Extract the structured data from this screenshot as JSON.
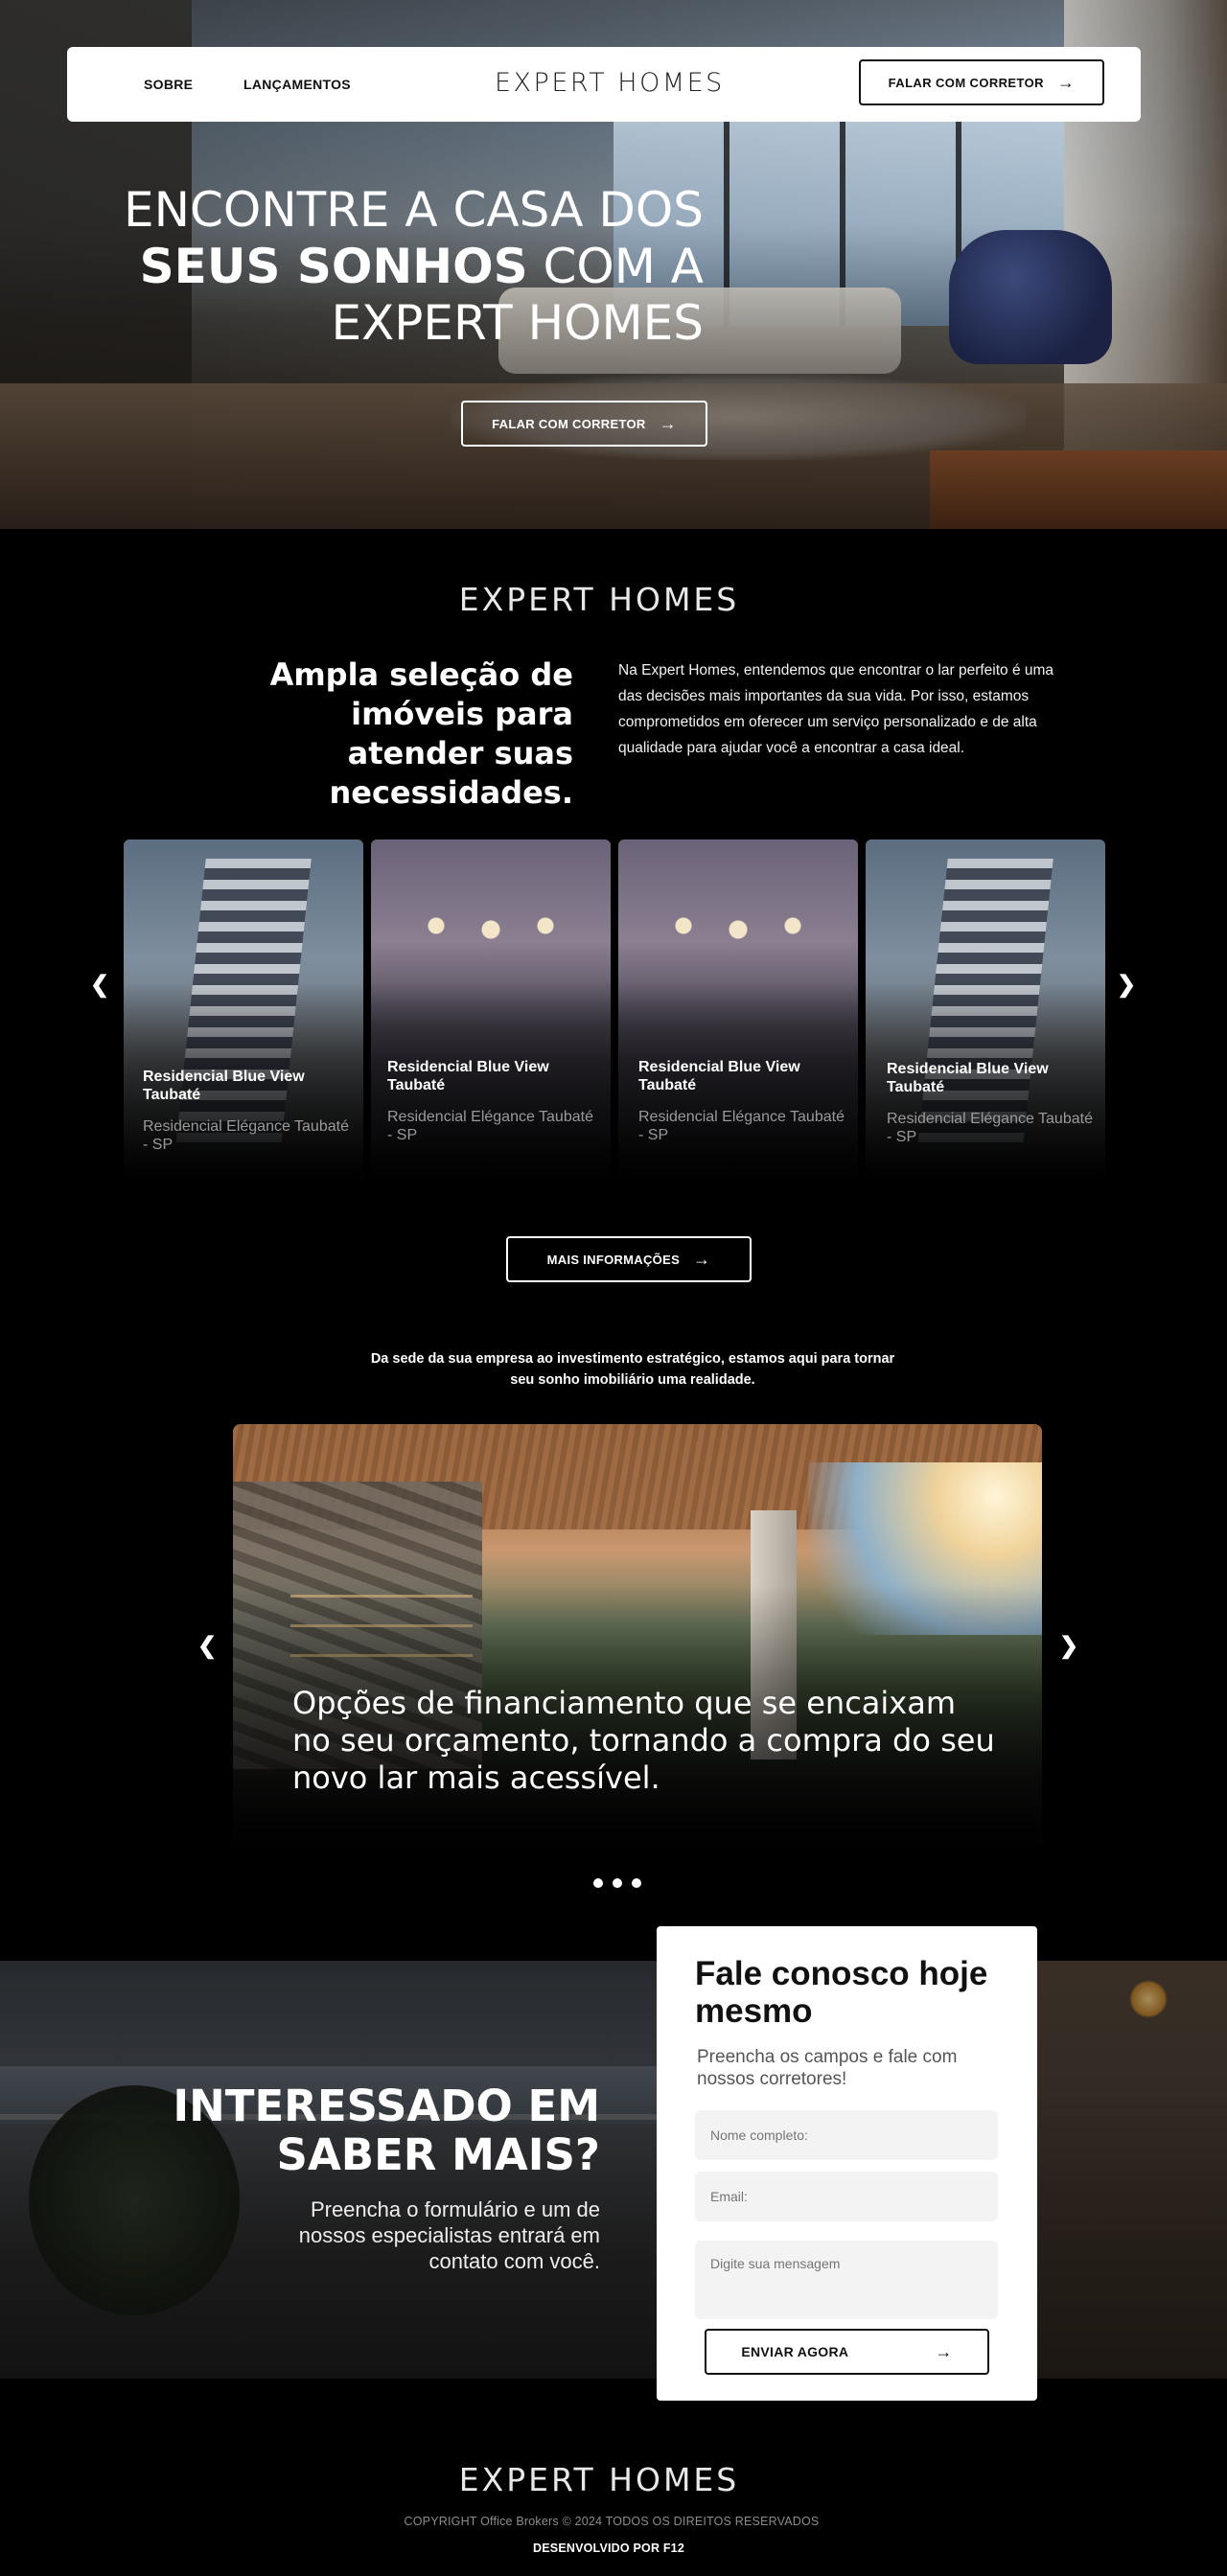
{
  "header": {
    "nav": [
      {
        "label": "SOBRE"
      },
      {
        "label": "LANÇAMENTOS"
      }
    ],
    "brand": "EXPERT HOMES",
    "cta_label": "FALAR COM CORRETOR"
  },
  "hero": {
    "title_line1": "ENCONTRE A CASA DOS",
    "title_bold": "SEUS SONHOS",
    "title_line2_rest": " COM A",
    "title_line3": "EXPERT HOMES",
    "cta_label": "FALAR COM CORRETOR"
  },
  "about": {
    "brand": "EXPERT HOMES",
    "heading_light": "Ampla seleção de imóveis para ",
    "heading_bold": "atender suas necessidades.",
    "text": "Na Expert Homes, entendemos que encontrar o lar perfeito é uma das decisões mais importantes da sua vida. Por isso, estamos comprometidos em oferecer um serviço personalizado e de alta qualidade para ajudar você a encontrar a casa ideal."
  },
  "properties": {
    "cards": [
      {
        "title": "Residencial Blue View Taubaté",
        "subtitle": "Residencial Elégance Taubaté - SP",
        "image": "building"
      },
      {
        "title": "Residencial Blue View Taubaté",
        "subtitle": "Residencial Elégance Taubaté - SP",
        "image": "interior"
      },
      {
        "title": "Residencial Blue View Taubaté",
        "subtitle": "Residencial Elégance Taubaté - SP",
        "image": "interior"
      },
      {
        "title": "Residencial Blue View Taubaté",
        "subtitle": "Residencial Elégance Taubaté - SP",
        "image": "building"
      }
    ],
    "more_label": "MAIS INFORMAÇÕES"
  },
  "tagline": "Da sede da sua empresa ao investimento estratégico, estamos aqui para tornar seu sonho imobiliário uma realidade.",
  "slider": {
    "caption": "Opções de financiamento que se encaixam no seu orçamento, tornando a compra do seu novo lar mais acessível.",
    "dots": 3
  },
  "contact": {
    "heading": "INTERESSADO EM SABER MAIS?",
    "subtext": "Preencha o formulário e um de nossos especialistas entrará em contato com você.",
    "form": {
      "title": "Fale conosco hoje mesmo",
      "subtitle": "Preencha os campos e fale com nossos corretores!",
      "name_placeholder": "Nome completo:",
      "email_placeholder": "Email:",
      "message_placeholder": "Digite sua mensagem",
      "submit_label": "ENVIAR AGORA"
    }
  },
  "footer": {
    "brand": "EXPERT HOMES",
    "copyright": "COPYRIGHT Office Brokers © 2024 TODOS OS DIREITOS RESERVADOS",
    "developer": "DESENVOLVIDO POR F12"
  },
  "icons": {
    "arrow": "arrow-right-icon",
    "prev": "chevron-left-icon",
    "next": "chevron-right-icon"
  }
}
